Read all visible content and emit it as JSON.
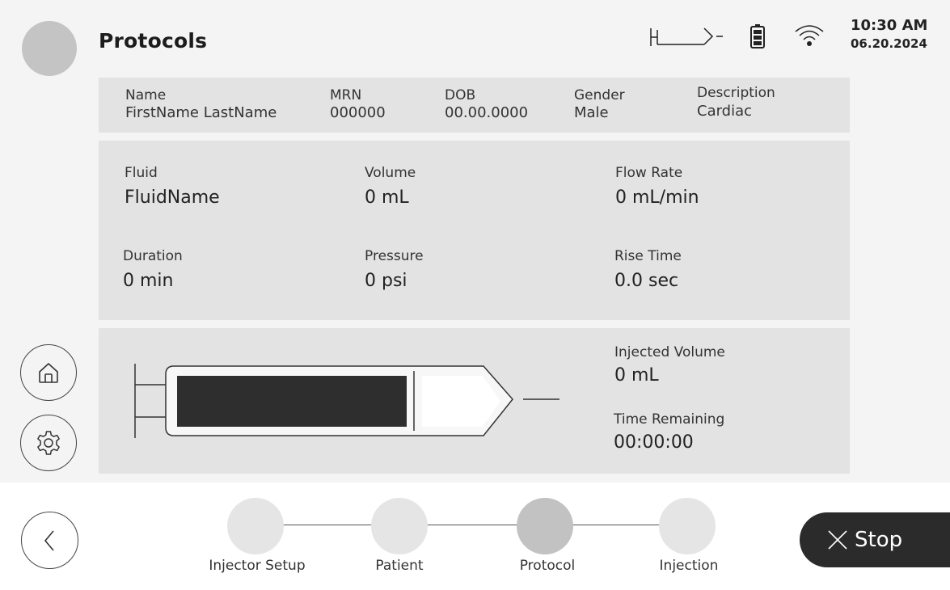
{
  "header": {
    "title": "Protocols",
    "time": "10:30 AM",
    "date": "06.20.2024",
    "icons": [
      "syringe-status-icon",
      "battery-icon",
      "wifi-icon"
    ]
  },
  "patient": {
    "name_label": "Name",
    "name_value": "FirstName LastName",
    "mrn_label": "MRN",
    "mrn_value": "000000",
    "dob_label": "DOB",
    "dob_value": "00.00.0000",
    "gender_label": "Gender",
    "gender_value": "Male",
    "description_label": "Description",
    "description_value": "Cardiac"
  },
  "protocol": {
    "fluid_label": "Fluid",
    "fluid_value": "FluidName",
    "volume_label": "Volume",
    "volume_value": "0 mL",
    "flow_rate_label": "Flow Rate",
    "flow_rate_value": "0 mL/min",
    "duration_label": "Duration",
    "duration_value": "0 min",
    "pressure_label": "Pressure",
    "pressure_value": "0 psi",
    "rise_time_label": "Rise Time",
    "rise_time_value": "0.0 sec"
  },
  "injection": {
    "injected_volume_label": "Injected Volume",
    "injected_volume_value": "0 mL",
    "time_remaining_label": "Time Remaining",
    "time_remaining_value": "00:00:00"
  },
  "steps": [
    {
      "label": "Injector Setup",
      "active": false
    },
    {
      "label": "Patient",
      "active": false
    },
    {
      "label": "Protocol",
      "active": true
    },
    {
      "label": "Injection",
      "active": false
    }
  ],
  "stop_label": "Stop",
  "colors": {
    "accent_dark": "#2b2b2b",
    "panel": "#e3e3e3",
    "step_active": "#c2c2c2",
    "step_inactive": "#e5e5e5"
  }
}
